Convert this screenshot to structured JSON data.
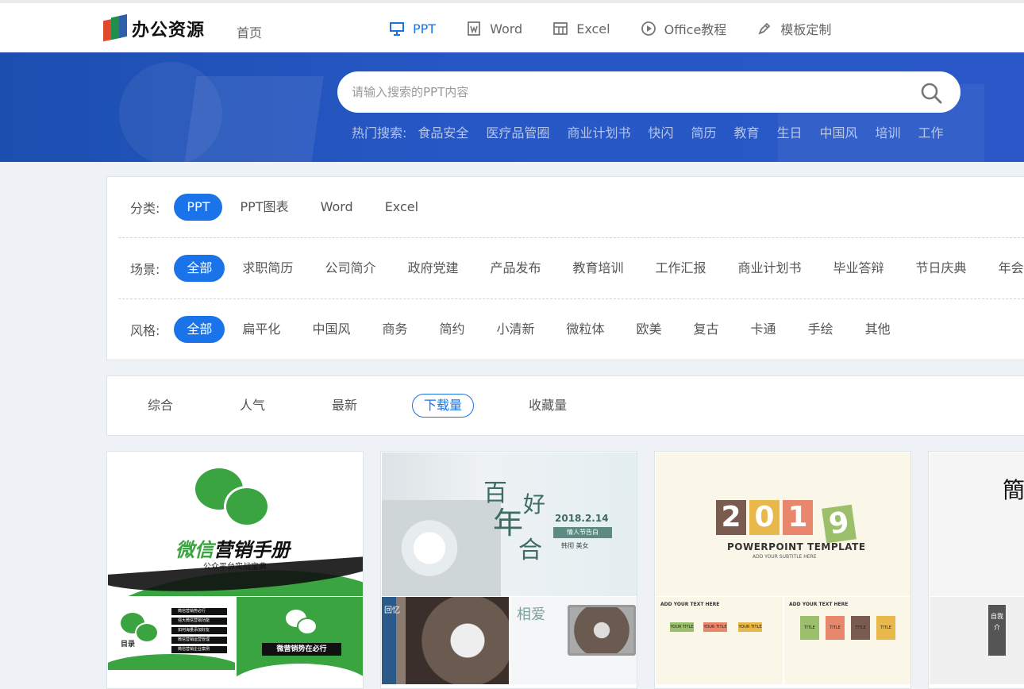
{
  "brand": {
    "logo_text": "办公资源"
  },
  "nav": {
    "home": "首页",
    "tabs": [
      {
        "label": "PPT",
        "icon": "presentation-icon",
        "active": true
      },
      {
        "label": "Word",
        "icon": "word-doc-icon",
        "active": false
      },
      {
        "label": "Excel",
        "icon": "table-icon",
        "active": false
      },
      {
        "label": "Office教程",
        "icon": "play-circle-icon",
        "active": false
      },
      {
        "label": "模板定制",
        "icon": "pen-icon",
        "active": false
      }
    ]
  },
  "search": {
    "placeholder": "请输入搜索的PPT内容",
    "value": "",
    "hot_label": "热门搜索:",
    "hot_items": [
      "食品安全",
      "医疗品管圈",
      "商业计划书",
      "快闪",
      "简历",
      "教育",
      "生日",
      "中国风",
      "培训",
      "工作"
    ]
  },
  "filters": {
    "category": {
      "label": "分类:",
      "items": [
        "PPT",
        "PPT图表",
        "Word",
        "Excel"
      ],
      "active": 0
    },
    "scene": {
      "label": "场景:",
      "items": [
        "全部",
        "求职简历",
        "公司简介",
        "政府党建",
        "产品发布",
        "教育培训",
        "工作汇报",
        "商业计划书",
        "毕业答辩",
        "节日庆典",
        "年会"
      ],
      "active": 0
    },
    "style": {
      "label": "风格:",
      "items": [
        "全部",
        "扁平化",
        "中国风",
        "商务",
        "简约",
        "小清新",
        "微粒体",
        "欧美",
        "复古",
        "卡通",
        "手绘",
        "其他"
      ],
      "active": 0
    }
  },
  "sort": {
    "items": [
      "综合",
      "人气",
      "最新",
      "下载量",
      "收藏量"
    ],
    "active": 3
  },
  "cards": [
    {
      "title_green": "微信",
      "title_rest": "营销手册",
      "subtitle": "公众平台实战宝典",
      "sub_left_label": "目录",
      "sub_left_items": [
        "微信营销势必行",
        "强大微信营销功能",
        "如何海量添加好友",
        "微信营销运营管理",
        "微信营销企业案例"
      ],
      "sub_right_caption": "微营销势在必行"
    },
    {
      "chars": [
        "百",
        "年",
        "好",
        "合"
      ],
      "date": "2018.2.14",
      "tag": "情人节告白",
      "names": "韩彻    美女",
      "sub_left_chars": "回忆",
      "sub_right_chars": "相爱"
    },
    {
      "year": [
        "2",
        "0",
        "1",
        "9"
      ],
      "year_colors": [
        "#7a5b4f",
        "#e9b84a",
        "#e8876c",
        "#9bbf6b"
      ],
      "title": "POWERPOINT TEMPLATE",
      "subtitle": "ADD YOUR SUBTITLE HERE",
      "sub_head": "ADD YOUR TEXT HERE",
      "sub_box": "YOUR TITLE",
      "sub_small": "TITLE"
    },
    {
      "title_char": "簡",
      "sub_chars": "自我介"
    }
  ],
  "colors": {
    "primary": "#1a73e8",
    "banner": "#2757c5",
    "wechat_green": "#3aa441"
  }
}
